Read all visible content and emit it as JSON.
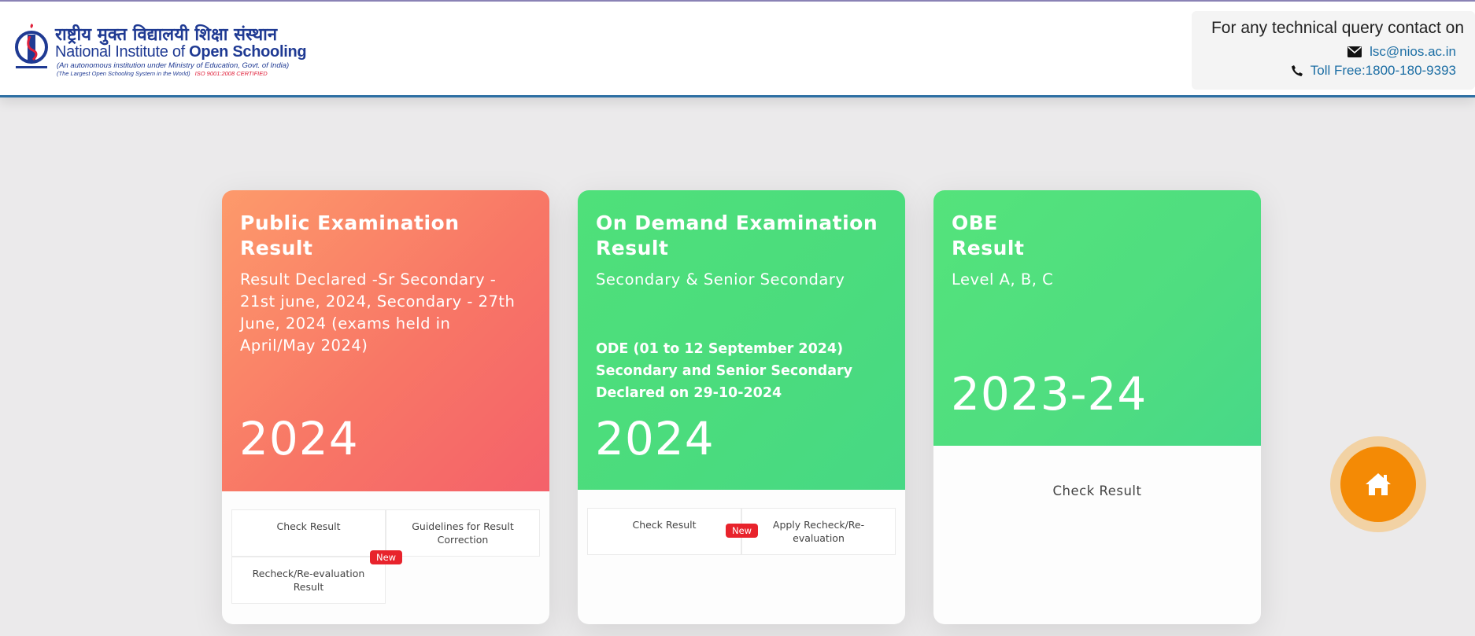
{
  "header": {
    "logo": {
      "hindi_name": "राष्ट्रीय मुक्त विद्यालयी शिक्षा संस्थान",
      "english_name_part1": "National Institute of ",
      "english_name_part2": "Open Schooling",
      "subtitle1": "(An autonomous institution under Ministry of Education, Govt. of India)",
      "subtitle2": "(The Largest Open Schooling System in the World)",
      "iso": "ISO 9001:2008 CERTIFIED"
    },
    "contact": {
      "title": "For any technical query contact on",
      "email": "lsc@nios.ac.in",
      "phone": "Toll Free:1800-180-9393",
      "email_icon": "envelope-icon",
      "phone_icon": "phone-icon"
    }
  },
  "cards": [
    {
      "title": "Public Examination Result",
      "description": "Result Declared -Sr Secondary - 21st june, 2024, Secondary - 27th June, 2024 (exams held in April/May 2024)",
      "year": "2024",
      "buttons": [
        "Check Result",
        "Guidelines for Result Correction",
        "Recheck/Re-evaluation Result"
      ],
      "badge": "New",
      "gradient": [
        "#fd9a6b",
        "#f4616a"
      ]
    },
    {
      "title": "On Demand Examination Result",
      "description": "Secondary & Senior Secondary",
      "note": "ODE (01 to 12 September 2024) Secondary and Senior Secondary Declared on 29-10-2024",
      "year": "2024",
      "buttons": [
        "Check Result",
        "Apply Recheck/Re-evaluation"
      ],
      "badge": "New",
      "gradient": [
        "#4fe07a",
        "#47d884"
      ]
    },
    {
      "title_line1": "OBE",
      "title_line2": "Result",
      "description": "Level A, B, C",
      "year": "2023-24",
      "link": "Check Result",
      "gradient": [
        "#54e37b",
        "#48d888"
      ]
    }
  ],
  "home_button": {
    "icon": "home-icon",
    "color": "#f48a05"
  }
}
